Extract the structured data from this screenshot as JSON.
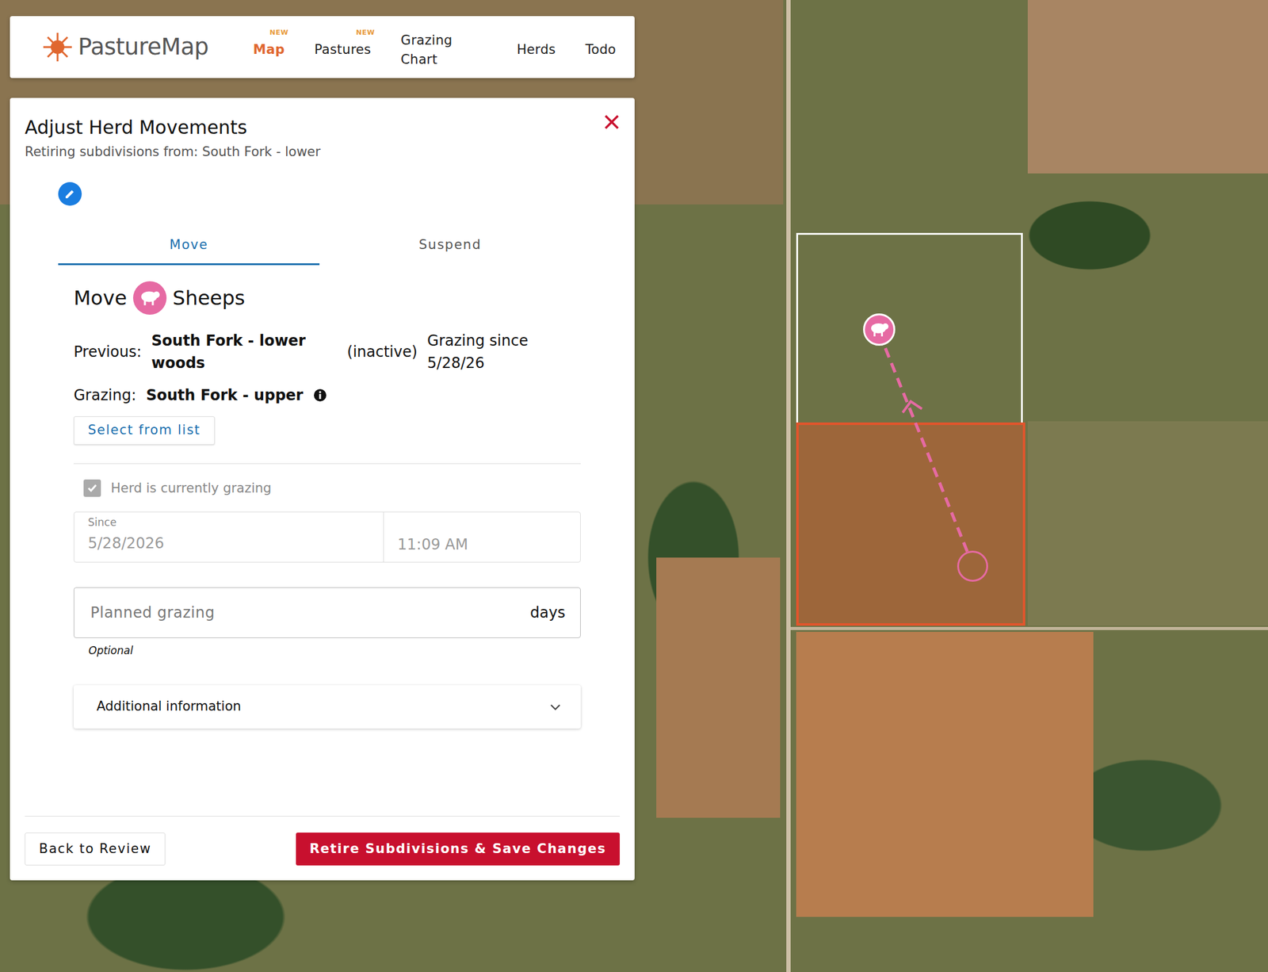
{
  "app": {
    "logo": "PastureMap"
  },
  "nav": [
    {
      "label": "Map",
      "badge": "NEW",
      "selected": true
    },
    {
      "label": "Pastures",
      "badge": "NEW",
      "selected": false
    },
    {
      "label": "Grazing Chart",
      "selected": false
    },
    {
      "label": "Herds",
      "selected": false
    },
    {
      "label": "Todo",
      "selected": false
    }
  ],
  "panel": {
    "title": "Adjust Herd Movements",
    "subtitle": "Retiring subdivisions from: South Fork - lower"
  },
  "tabs": [
    {
      "label": "Move",
      "selected": true
    },
    {
      "label": "Suspend",
      "selected": false
    }
  ],
  "move": {
    "verb": "Move",
    "herd": "Sheeps",
    "previous_label": "Previous:",
    "previous_pasture": "South Fork - lower woods",
    "previous_status": "(inactive)",
    "previous_since": "Grazing since 5/28/26",
    "grazing_label": "Grazing:",
    "grazing_pasture": "South Fork - upper",
    "select_button": "Select from list"
  },
  "currently_grazing": {
    "label": "Herd is currently grazing",
    "checked": true,
    "disabled": true
  },
  "since": {
    "label": "Since",
    "date": "5/28/2026",
    "time": "11:09 AM"
  },
  "planned": {
    "placeholder": "Planned grazing",
    "unit": "days",
    "hint": "Optional"
  },
  "additional": {
    "label": "Additional information",
    "expanded": false
  },
  "buttons": {
    "back": "Back to Review",
    "save": "Retire Subdivisions & Save Changes"
  },
  "map": {
    "pastures": [
      {
        "selected": false
      },
      {
        "selected": true
      }
    ]
  }
}
